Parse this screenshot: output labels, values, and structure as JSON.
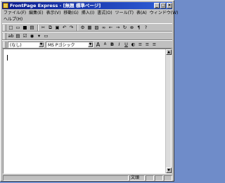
{
  "window": {
    "title": "FrontPage Express - [無題 標準ページ]",
    "buttons": {
      "minimize": "_",
      "maximize": "□",
      "close": "×"
    }
  },
  "menubar": {
    "row1": [
      "ファイル(F)",
      "編集(E)",
      "表示(V)",
      "移動(G)",
      "挿入(I)",
      "書式(O)",
      "ツール(T)",
      "表(A)",
      "ウィンドウ(W)"
    ],
    "row2": [
      "ヘルプ(H)"
    ]
  },
  "toolbar_standard": {
    "icons": [
      "new-icon",
      "open-icon",
      "save-icon",
      "print-icon",
      "cut-icon",
      "copy-icon",
      "paste-icon",
      "undo-icon",
      "redo-icon",
      "webbot-icon",
      "table-icon",
      "image-icon",
      "hyperlink-icon",
      "back-icon",
      "forward-icon",
      "refresh-icon",
      "stop-icon",
      "show-marks-icon",
      "help-icon"
    ],
    "glyphs": [
      "□",
      "▭",
      "■",
      "▤",
      "✂",
      "⧉",
      "▣",
      "↶",
      "↷",
      "⚙",
      "▦",
      "▨",
      "∞",
      "←",
      "→",
      "↻",
      "⊗",
      "¶",
      "?"
    ]
  },
  "toolbar_forms": {
    "icons": [
      "textbox-icon",
      "scrolling-textbox-icon",
      "checkbox-icon",
      "radio-icon",
      "dropdown-icon",
      "push-button-icon"
    ],
    "glyphs": [
      "ab",
      "▤",
      "☑",
      "◉",
      "▾",
      "▭"
    ]
  },
  "toolbar_format": {
    "style_value": "(なし)",
    "font_value": "MS Pゴシック",
    "icons": [
      "increase-text-size-icon",
      "decrease-text-size-icon",
      "bold-icon",
      "italic-icon",
      "underline-icon",
      "text-color-icon",
      "align-left-icon",
      "align-center-icon",
      "align-right-icon"
    ],
    "glyphs": [
      "A",
      "A",
      "B",
      "I",
      "U",
      "◐",
      "≡",
      "≡",
      "≡"
    ]
  },
  "statusbar": {
    "mode": "文頭"
  }
}
